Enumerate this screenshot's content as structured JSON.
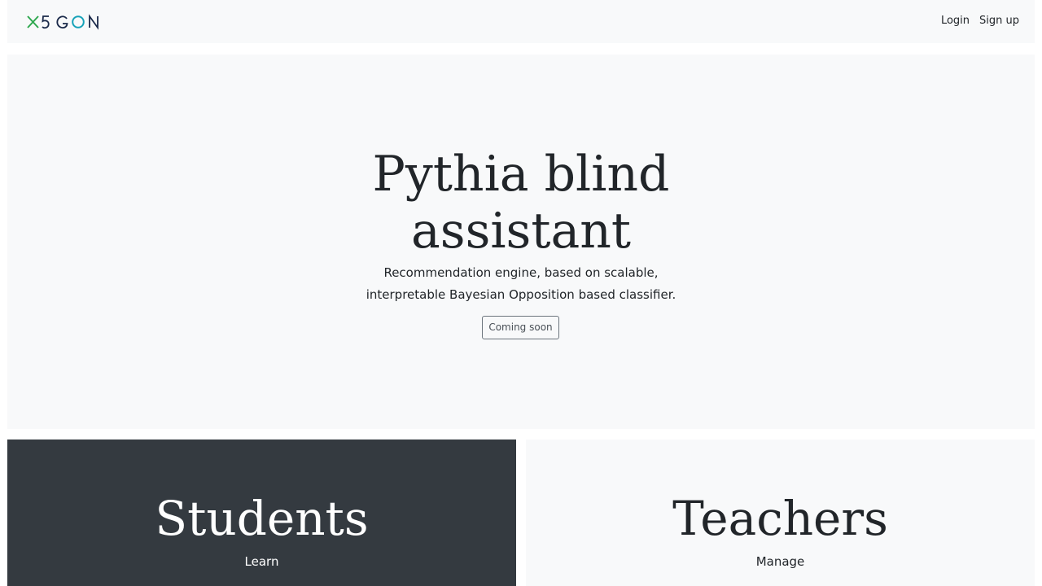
{
  "navbar": {
    "brand": {
      "name": "X5GON",
      "icon": "x5gon-logo",
      "colors": {
        "x": "#2fa84f",
        "text": "#1b2a4a",
        "o": "#17a2b8"
      }
    },
    "links": [
      {
        "label": "Login"
      },
      {
        "label": "Sign up"
      }
    ]
  },
  "hero": {
    "title_line1": "Pythia blind",
    "title_line2": "assistant",
    "desc_line1": "Recommendation engine, based on scalable,",
    "desc_line2": "interpretable Bayesian Opposition based classifier.",
    "button_label": "Coming soon"
  },
  "panels": [
    {
      "title": "Students",
      "subtitle": "Learn",
      "background": "#343a40"
    },
    {
      "title": "Teachers",
      "subtitle": "Manage",
      "background": "#f8f9fa"
    }
  ]
}
